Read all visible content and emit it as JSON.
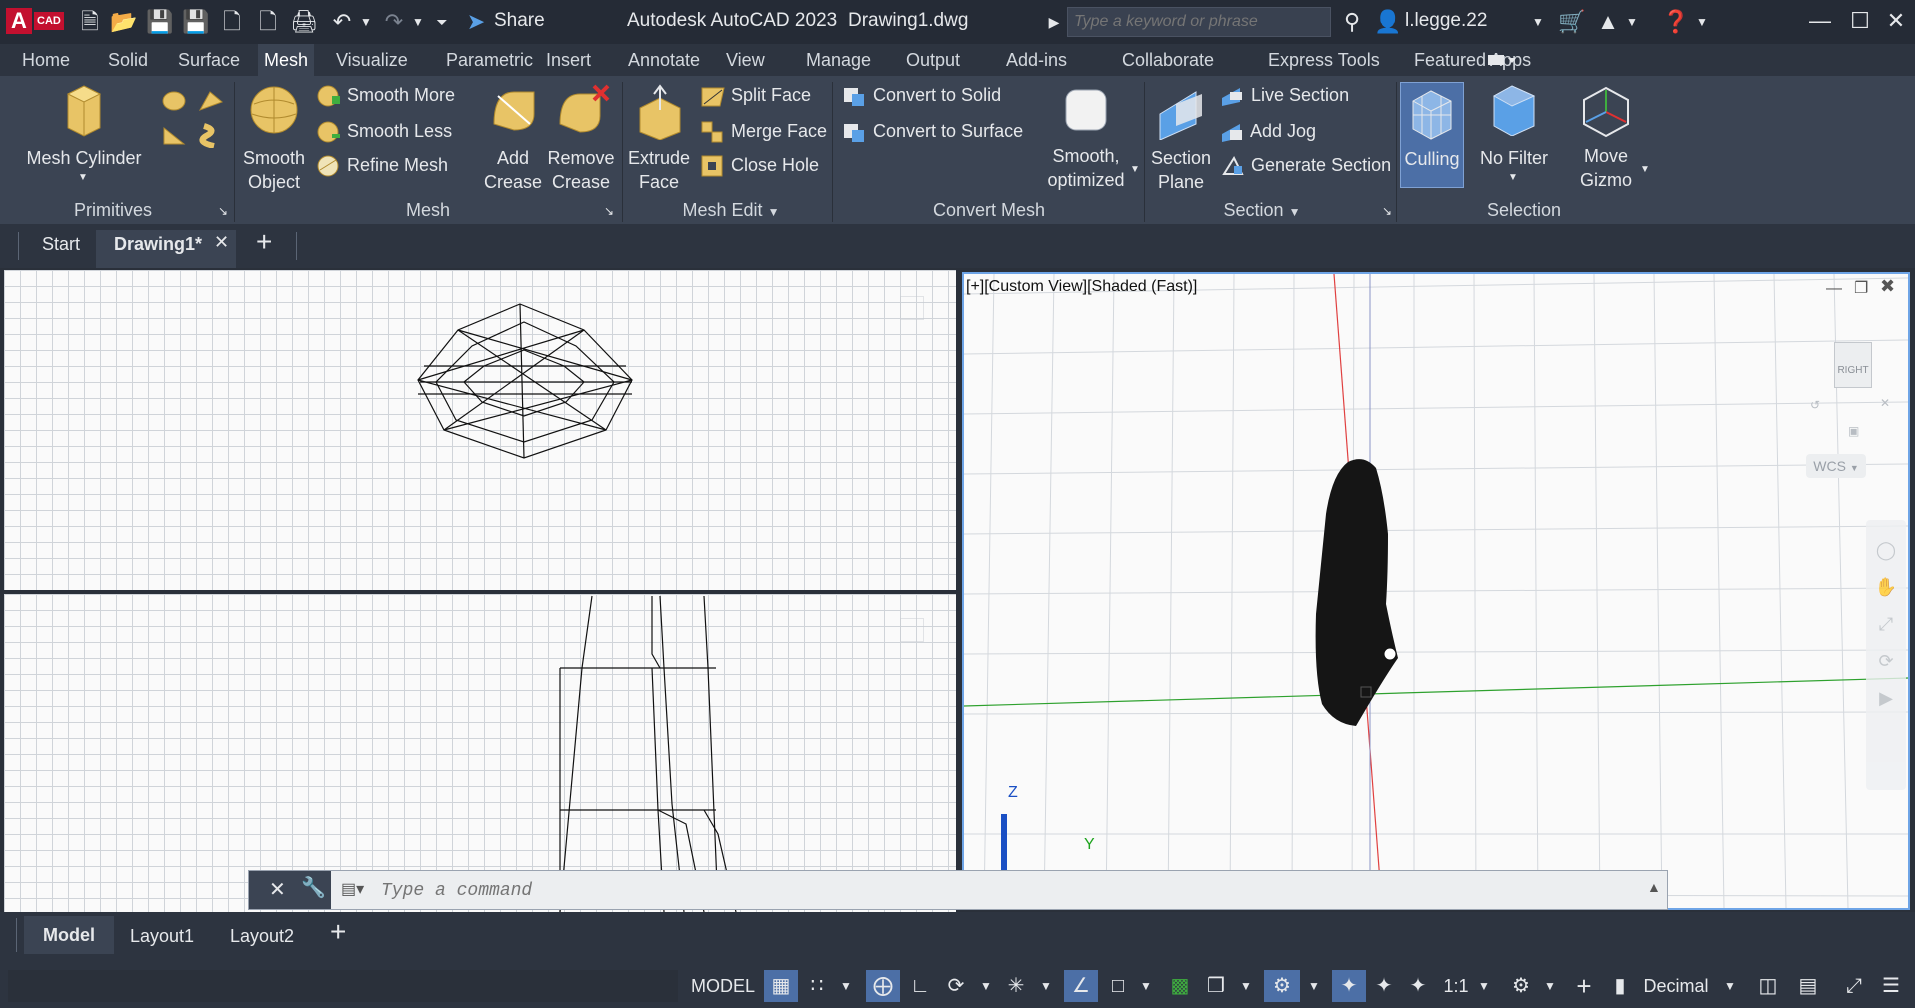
{
  "app": {
    "title": "Autodesk AutoCAD 2023",
    "file": "Drawing1.dwg",
    "logo": "A",
    "logo_sub": "CAD",
    "share": "Share",
    "search_placeholder": "Type a keyword or phrase",
    "user": "l.legge.22"
  },
  "ribbon_tabs": [
    "Home",
    "Solid",
    "Surface",
    "Mesh",
    "Visualize",
    "Parametric",
    "Insert",
    "Annotate",
    "View",
    "Manage",
    "Output",
    "Add-ins",
    "Collaborate",
    "Express Tools",
    "Featured Apps"
  ],
  "active_tab": "Mesh",
  "panels": {
    "primitives": {
      "title": "Primitives",
      "mesh_cylinder": "Mesh Cylinder"
    },
    "mesh": {
      "title": "Mesh",
      "smooth_object": "Smooth\nObject",
      "smooth_more": "Smooth More",
      "smooth_less": "Smooth Less",
      "refine_mesh": "Refine Mesh",
      "add_crease": "Add\nCrease",
      "remove_crease": "Remove\nCrease"
    },
    "mesh_edit": {
      "title": "Mesh Edit",
      "extrude_face": "Extrude\nFace",
      "split_face": "Split Face",
      "merge_face": "Merge Face",
      "close_hole": "Close Hole"
    },
    "convert_mesh": {
      "title": "Convert Mesh",
      "convert_to_solid": "Convert to Solid",
      "convert_to_surface": "Convert to Surface",
      "smooth_optimized": "Smooth,\noptimized"
    },
    "section": {
      "title": "Section",
      "section_plane": "Section\nPlane",
      "live_section": "Live Section",
      "add_jog": "Add Jog",
      "generate_section": "Generate Section"
    },
    "selection": {
      "title": "Selection",
      "culling": "Culling",
      "no_filter": "No Filter",
      "move_gizmo": "Move\nGizmo"
    }
  },
  "doc_tabs": {
    "start": "Start",
    "drawing": "Drawing1*"
  },
  "viewport_label": "[+][Custom View][Shaded (Fast)]",
  "viewcube": {
    "face": "RIGHT",
    "wcs": "WCS"
  },
  "axes": {
    "z": "Z",
    "y": "Y"
  },
  "command_placeholder": "Type a command",
  "layout_tabs": [
    "Model",
    "Layout1",
    "Layout2"
  ],
  "status": {
    "model": "MODEL",
    "scale": "1:1",
    "units": "Decimal"
  },
  "colors": {
    "accent": "#4c6fa6",
    "titlebar": "#252b36",
    "ribbon": "#3b4453",
    "logo": "#c3102f"
  }
}
